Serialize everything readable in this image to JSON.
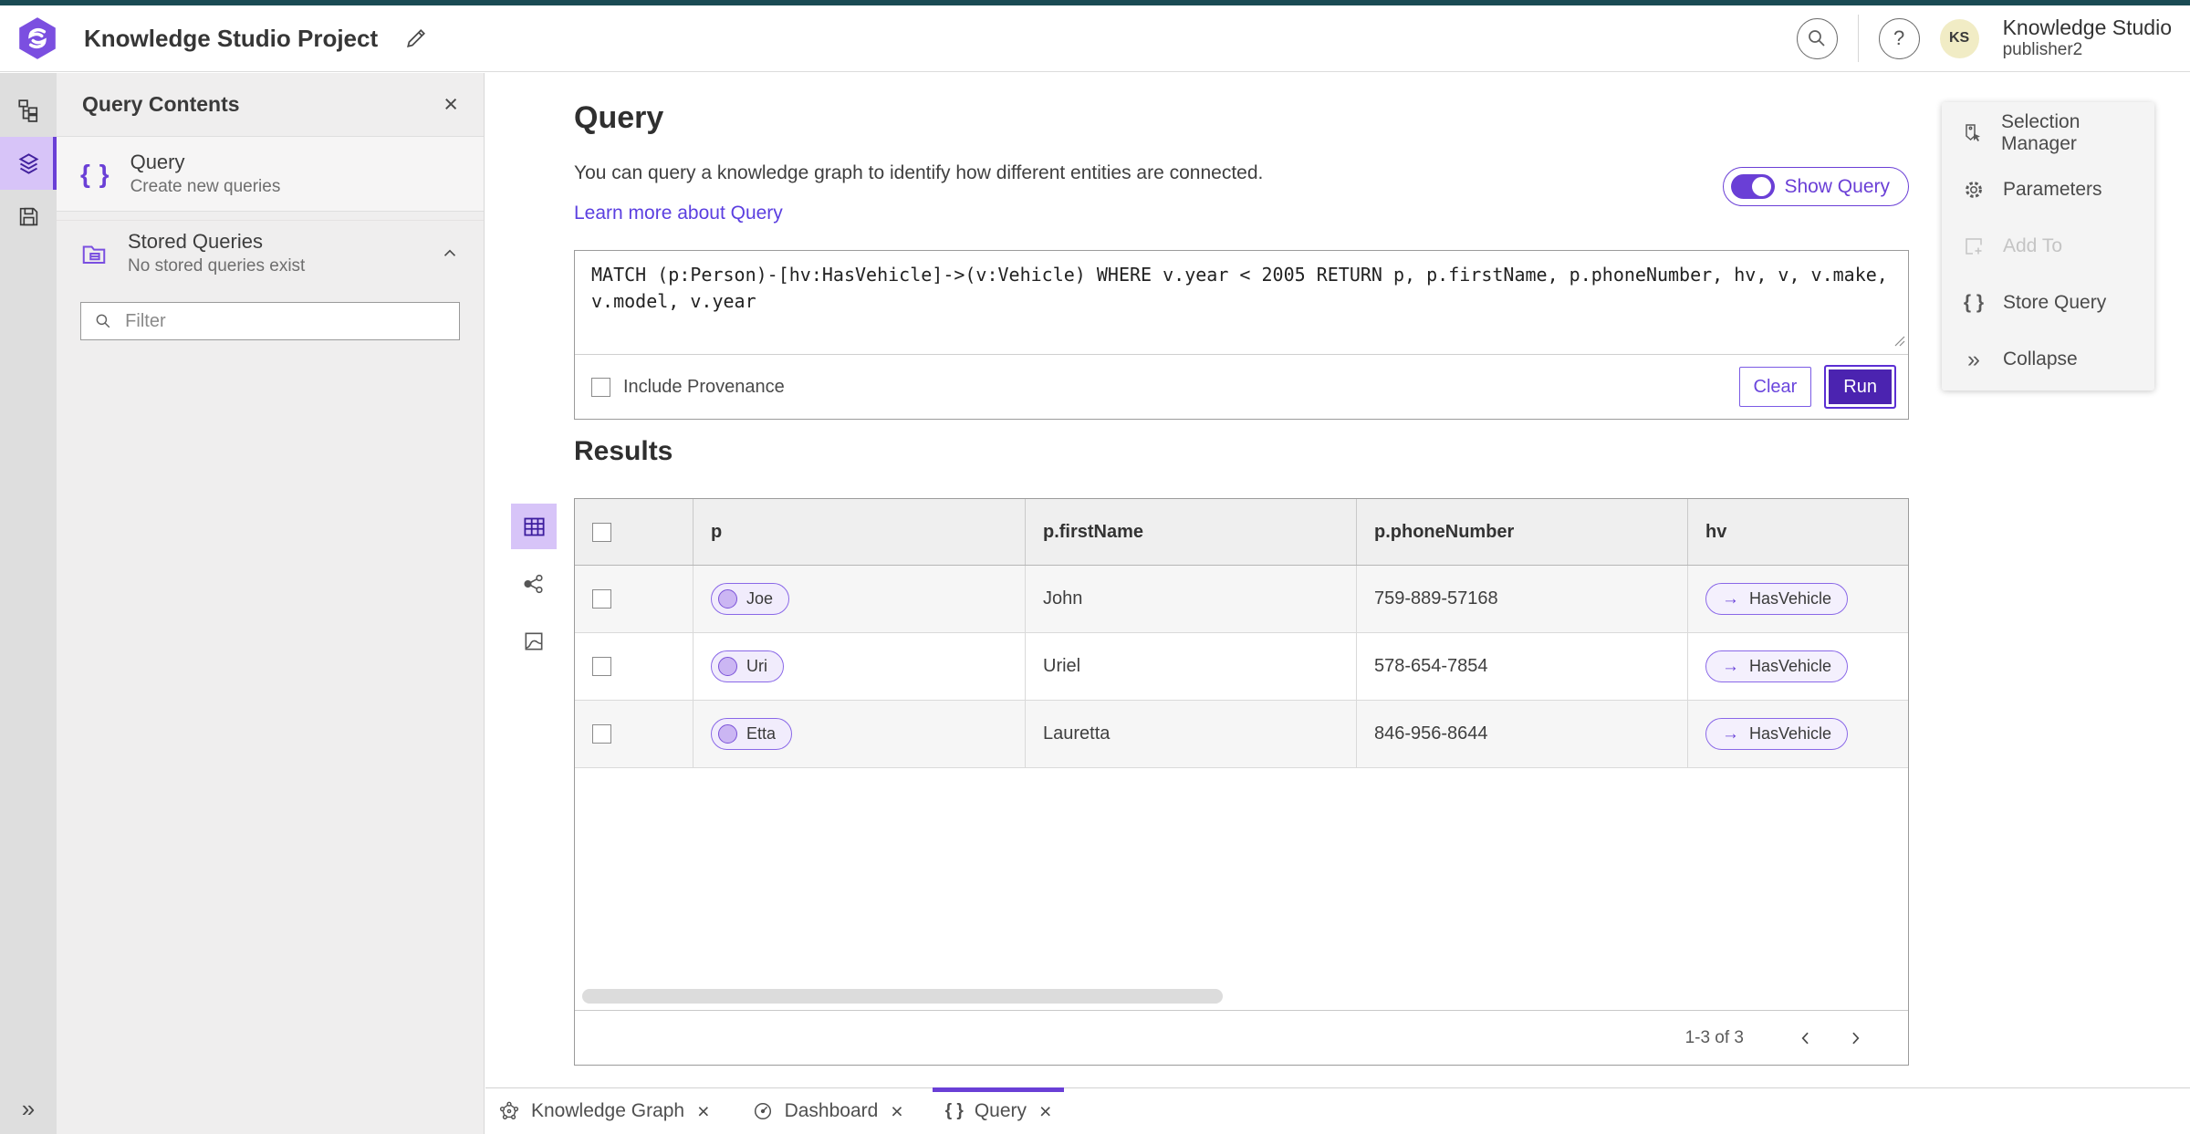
{
  "colors": {
    "accent": "#6a3fd6",
    "accent-dark": "#4b23b0",
    "link": "#5b3fe0",
    "topbar": "#1a4b54",
    "selection": "#d7c4f8",
    "avatar-bg": "#f1ecc5"
  },
  "icons": {
    "braces": "{ }",
    "close": "×",
    "collapse": "»",
    "arrow": "→",
    "question": "?"
  },
  "header": {
    "title": "Knowledge Studio Project",
    "product": "Knowledge Studio",
    "user": "publisher2",
    "avatar_initials": "KS"
  },
  "contents_panel": {
    "title": "Query Contents",
    "items": [
      {
        "label": "Query",
        "description": "Create new queries"
      },
      {
        "label": "Stored Queries",
        "description": "No stored queries exist"
      }
    ],
    "filter_placeholder": "Filter"
  },
  "query_section": {
    "title": "Query",
    "description": "You can query a knowledge graph to identify how different entities are connected.",
    "learn_more": "Learn more about Query",
    "show_query_label": "Show Query",
    "query_text": "MATCH (p:Person)-[hv:HasVehicle]->(v:Vehicle) WHERE v.year < 2005 RETURN p, p.firstName, p.phoneNumber, hv, v, v.make, v.model, v.year",
    "include_provenance_label": "Include Provenance",
    "clear_label": "Clear",
    "run_label": "Run"
  },
  "results": {
    "title": "Results",
    "columns": [
      "p",
      "p.firstName",
      "p.phoneNumber",
      "hv"
    ],
    "rows": [
      {
        "entity": "Joe",
        "firstName": "John",
        "phoneNumber": "759-889-57168",
        "relationship": "HasVehicle"
      },
      {
        "entity": "Uri",
        "firstName": "Uriel",
        "phoneNumber": "578-654-7854",
        "relationship": "HasVehicle"
      },
      {
        "entity": "Etta",
        "firstName": "Lauretta",
        "phoneNumber": "846-956-8644",
        "relationship": "HasVehicle"
      }
    ],
    "pagination": "1-3 of 3"
  },
  "actions_panel": {
    "items": [
      {
        "label": "Selection Manager"
      },
      {
        "label": "Parameters"
      },
      {
        "label": "Add To"
      },
      {
        "label": "Store Query"
      },
      {
        "label": "Collapse"
      }
    ]
  },
  "tabs": [
    {
      "label": "Knowledge Graph"
    },
    {
      "label": "Dashboard"
    },
    {
      "label": "Query"
    }
  ]
}
